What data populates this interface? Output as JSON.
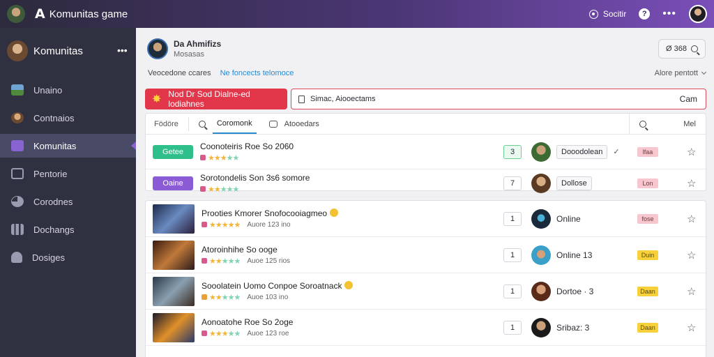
{
  "colors": {
    "accent": "#8a63d2",
    "alert": "#e2364a",
    "link": "#2a8ad0",
    "online_tag": "#2ebf8a"
  },
  "topbar": {
    "logo": "A",
    "title": "Komunitas game",
    "search_label": "Socitir",
    "help": "?",
    "more": "•••"
  },
  "sidebar": {
    "title": "Komunitas",
    "more": "•••",
    "items": [
      {
        "label": "Unaino",
        "icon": "landscape-icon"
      },
      {
        "label": "Contnaios",
        "icon": "avatar-icon"
      },
      {
        "label": "Komunitas",
        "icon": "community-icon",
        "active": true
      },
      {
        "label": "Pentorie",
        "icon": "monitor-icon"
      },
      {
        "label": "Corodnes",
        "icon": "pie-icon"
      },
      {
        "label": "Dochangs",
        "icon": "bars-icon"
      },
      {
        "label": "Dosiges",
        "icon": "people-icon"
      }
    ]
  },
  "profile": {
    "name": "Da Ahmifizs",
    "sub": "Mosasas"
  },
  "top_search": {
    "label": "Ø 368"
  },
  "info": {
    "text": "Veocedone ccares",
    "link": "Ne foncects telomoce",
    "right": "Alore pentott"
  },
  "alert_button": {
    "label": "Nod Dr Sod Dialne-ed lodiahnes"
  },
  "command": {
    "value": "Simac, Aiooectams",
    "action": "Cam"
  },
  "table_head": {
    "first": "Födöre",
    "tab": "Coromonk",
    "third": "Atooedars",
    "right": "Mel"
  },
  "top_rows": [
    {
      "tag": "Getee",
      "title": "Coonoteiris Roe So 2060",
      "time": "",
      "count": "3",
      "user": "Dooodolean",
      "badge": "lfaa"
    },
    {
      "tag": "Oaine",
      "title": "Sorotondelis Son 3s6 somore",
      "time": "",
      "count": "7",
      "user": "Dollose",
      "badge": "Lon"
    }
  ],
  "rows": [
    {
      "title": "Prooties Kmorer Snofocooiagmeo",
      "time": "Auore 123 ino",
      "count": "1",
      "user": "Online",
      "badge": "fose"
    },
    {
      "title": "Atoroinhihe So ooge",
      "time": "Auoe 125 rios",
      "count": "1",
      "user": "Online 13",
      "badge": "Duin"
    },
    {
      "title": "Sooolatein Uomo Conpoe Soroatnack",
      "time": "Auoe 103 ino",
      "count": "1",
      "user": "Dortoe · 3",
      "badge": "Daan"
    },
    {
      "title": "Aonoatohe Roe So 2oge",
      "time": "Auoe 123 roe",
      "count": "1",
      "user": "Sribaz: 3",
      "badge": "Daan"
    }
  ]
}
